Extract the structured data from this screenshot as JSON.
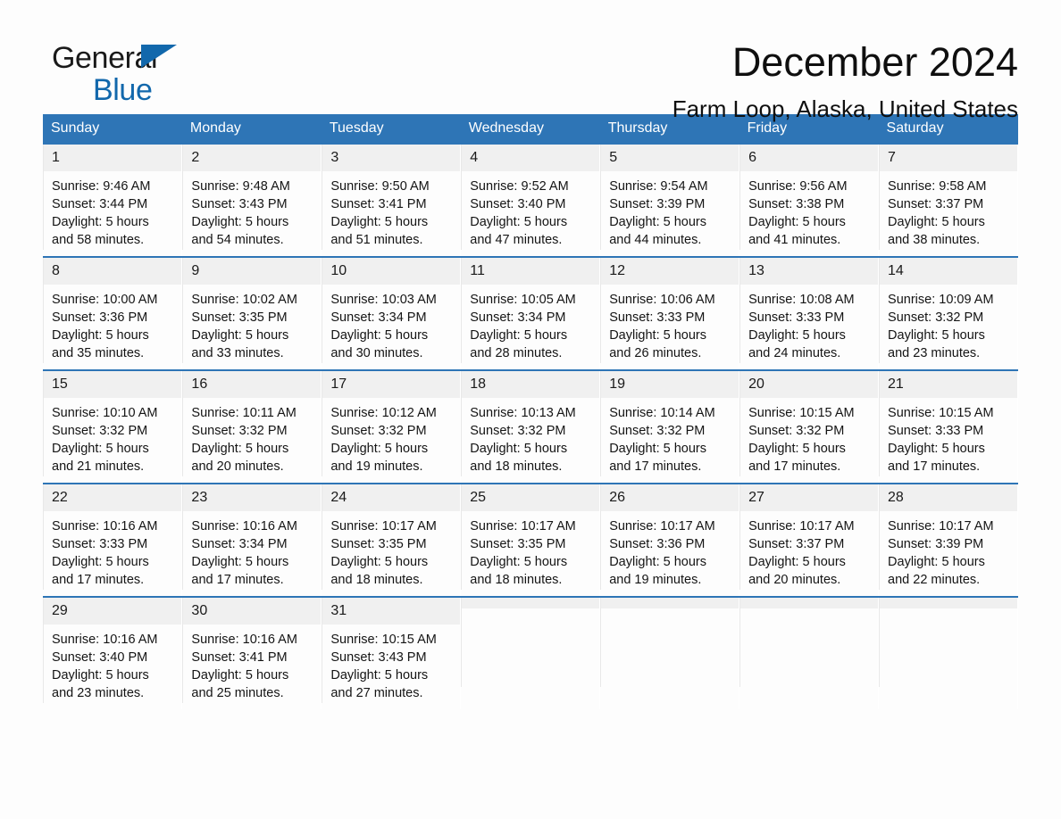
{
  "brand": {
    "name_part1": "General",
    "name_part2": "Blue",
    "triangle_color": "#1268ac"
  },
  "header": {
    "month_title": "December 2024",
    "location": "Farm Loop, Alaska, United States"
  },
  "colors": {
    "header_blue": "#2e75b6",
    "daynum_band": "#f0f0f0",
    "page_background": "#fdfdfd",
    "text": "#141414"
  },
  "calendar": {
    "weekday_headers": [
      "Sunday",
      "Monday",
      "Tuesday",
      "Wednesday",
      "Thursday",
      "Friday",
      "Saturday"
    ],
    "labels": {
      "sunrise_prefix": "Sunrise:",
      "sunset_prefix": "Sunset:",
      "daylight_prefix": "Daylight:"
    },
    "weeks": [
      [
        {
          "day": "1",
          "sunrise": "Sunrise: 9:46 AM",
          "sunset": "Sunset: 3:44 PM",
          "daylight_line1": "Daylight: 5 hours",
          "daylight_line2": "and 58 minutes."
        },
        {
          "day": "2",
          "sunrise": "Sunrise: 9:48 AM",
          "sunset": "Sunset: 3:43 PM",
          "daylight_line1": "Daylight: 5 hours",
          "daylight_line2": "and 54 minutes."
        },
        {
          "day": "3",
          "sunrise": "Sunrise: 9:50 AM",
          "sunset": "Sunset: 3:41 PM",
          "daylight_line1": "Daylight: 5 hours",
          "daylight_line2": "and 51 minutes."
        },
        {
          "day": "4",
          "sunrise": "Sunrise: 9:52 AM",
          "sunset": "Sunset: 3:40 PM",
          "daylight_line1": "Daylight: 5 hours",
          "daylight_line2": "and 47 minutes."
        },
        {
          "day": "5",
          "sunrise": "Sunrise: 9:54 AM",
          "sunset": "Sunset: 3:39 PM",
          "daylight_line1": "Daylight: 5 hours",
          "daylight_line2": "and 44 minutes."
        },
        {
          "day": "6",
          "sunrise": "Sunrise: 9:56 AM",
          "sunset": "Sunset: 3:38 PM",
          "daylight_line1": "Daylight: 5 hours",
          "daylight_line2": "and 41 minutes."
        },
        {
          "day": "7",
          "sunrise": "Sunrise: 9:58 AM",
          "sunset": "Sunset: 3:37 PM",
          "daylight_line1": "Daylight: 5 hours",
          "daylight_line2": "and 38 minutes."
        }
      ],
      [
        {
          "day": "8",
          "sunrise": "Sunrise: 10:00 AM",
          "sunset": "Sunset: 3:36 PM",
          "daylight_line1": "Daylight: 5 hours",
          "daylight_line2": "and 35 minutes."
        },
        {
          "day": "9",
          "sunrise": "Sunrise: 10:02 AM",
          "sunset": "Sunset: 3:35 PM",
          "daylight_line1": "Daylight: 5 hours",
          "daylight_line2": "and 33 minutes."
        },
        {
          "day": "10",
          "sunrise": "Sunrise: 10:03 AM",
          "sunset": "Sunset: 3:34 PM",
          "daylight_line1": "Daylight: 5 hours",
          "daylight_line2": "and 30 minutes."
        },
        {
          "day": "11",
          "sunrise": "Sunrise: 10:05 AM",
          "sunset": "Sunset: 3:34 PM",
          "daylight_line1": "Daylight: 5 hours",
          "daylight_line2": "and 28 minutes."
        },
        {
          "day": "12",
          "sunrise": "Sunrise: 10:06 AM",
          "sunset": "Sunset: 3:33 PM",
          "daylight_line1": "Daylight: 5 hours",
          "daylight_line2": "and 26 minutes."
        },
        {
          "day": "13",
          "sunrise": "Sunrise: 10:08 AM",
          "sunset": "Sunset: 3:33 PM",
          "daylight_line1": "Daylight: 5 hours",
          "daylight_line2": "and 24 minutes."
        },
        {
          "day": "14",
          "sunrise": "Sunrise: 10:09 AM",
          "sunset": "Sunset: 3:32 PM",
          "daylight_line1": "Daylight: 5 hours",
          "daylight_line2": "and 23 minutes."
        }
      ],
      [
        {
          "day": "15",
          "sunrise": "Sunrise: 10:10 AM",
          "sunset": "Sunset: 3:32 PM",
          "daylight_line1": "Daylight: 5 hours",
          "daylight_line2": "and 21 minutes."
        },
        {
          "day": "16",
          "sunrise": "Sunrise: 10:11 AM",
          "sunset": "Sunset: 3:32 PM",
          "daylight_line1": "Daylight: 5 hours",
          "daylight_line2": "and 20 minutes."
        },
        {
          "day": "17",
          "sunrise": "Sunrise: 10:12 AM",
          "sunset": "Sunset: 3:32 PM",
          "daylight_line1": "Daylight: 5 hours",
          "daylight_line2": "and 19 minutes."
        },
        {
          "day": "18",
          "sunrise": "Sunrise: 10:13 AM",
          "sunset": "Sunset: 3:32 PM",
          "daylight_line1": "Daylight: 5 hours",
          "daylight_line2": "and 18 minutes."
        },
        {
          "day": "19",
          "sunrise": "Sunrise: 10:14 AM",
          "sunset": "Sunset: 3:32 PM",
          "daylight_line1": "Daylight: 5 hours",
          "daylight_line2": "and 17 minutes."
        },
        {
          "day": "20",
          "sunrise": "Sunrise: 10:15 AM",
          "sunset": "Sunset: 3:32 PM",
          "daylight_line1": "Daylight: 5 hours",
          "daylight_line2": "and 17 minutes."
        },
        {
          "day": "21",
          "sunrise": "Sunrise: 10:15 AM",
          "sunset": "Sunset: 3:33 PM",
          "daylight_line1": "Daylight: 5 hours",
          "daylight_line2": "and 17 minutes."
        }
      ],
      [
        {
          "day": "22",
          "sunrise": "Sunrise: 10:16 AM",
          "sunset": "Sunset: 3:33 PM",
          "daylight_line1": "Daylight: 5 hours",
          "daylight_line2": "and 17 minutes."
        },
        {
          "day": "23",
          "sunrise": "Sunrise: 10:16 AM",
          "sunset": "Sunset: 3:34 PM",
          "daylight_line1": "Daylight: 5 hours",
          "daylight_line2": "and 17 minutes."
        },
        {
          "day": "24",
          "sunrise": "Sunrise: 10:17 AM",
          "sunset": "Sunset: 3:35 PM",
          "daylight_line1": "Daylight: 5 hours",
          "daylight_line2": "and 18 minutes."
        },
        {
          "day": "25",
          "sunrise": "Sunrise: 10:17 AM",
          "sunset": "Sunset: 3:35 PM",
          "daylight_line1": "Daylight: 5 hours",
          "daylight_line2": "and 18 minutes."
        },
        {
          "day": "26",
          "sunrise": "Sunrise: 10:17 AM",
          "sunset": "Sunset: 3:36 PM",
          "daylight_line1": "Daylight: 5 hours",
          "daylight_line2": "and 19 minutes."
        },
        {
          "day": "27",
          "sunrise": "Sunrise: 10:17 AM",
          "sunset": "Sunset: 3:37 PM",
          "daylight_line1": "Daylight: 5 hours",
          "daylight_line2": "and 20 minutes."
        },
        {
          "day": "28",
          "sunrise": "Sunrise: 10:17 AM",
          "sunset": "Sunset: 3:39 PM",
          "daylight_line1": "Daylight: 5 hours",
          "daylight_line2": "and 22 minutes."
        }
      ],
      [
        {
          "day": "29",
          "sunrise": "Sunrise: 10:16 AM",
          "sunset": "Sunset: 3:40 PM",
          "daylight_line1": "Daylight: 5 hours",
          "daylight_line2": "and 23 minutes."
        },
        {
          "day": "30",
          "sunrise": "Sunrise: 10:16 AM",
          "sunset": "Sunset: 3:41 PM",
          "daylight_line1": "Daylight: 5 hours",
          "daylight_line2": "and 25 minutes."
        },
        {
          "day": "31",
          "sunrise": "Sunrise: 10:15 AM",
          "sunset": "Sunset: 3:43 PM",
          "daylight_line1": "Daylight: 5 hours",
          "daylight_line2": "and 27 minutes."
        },
        {
          "day": "",
          "sunrise": "",
          "sunset": "",
          "daylight_line1": "",
          "daylight_line2": ""
        },
        {
          "day": "",
          "sunrise": "",
          "sunset": "",
          "daylight_line1": "",
          "daylight_line2": ""
        },
        {
          "day": "",
          "sunrise": "",
          "sunset": "",
          "daylight_line1": "",
          "daylight_line2": ""
        },
        {
          "day": "",
          "sunrise": "",
          "sunset": "",
          "daylight_line1": "",
          "daylight_line2": ""
        }
      ]
    ]
  }
}
